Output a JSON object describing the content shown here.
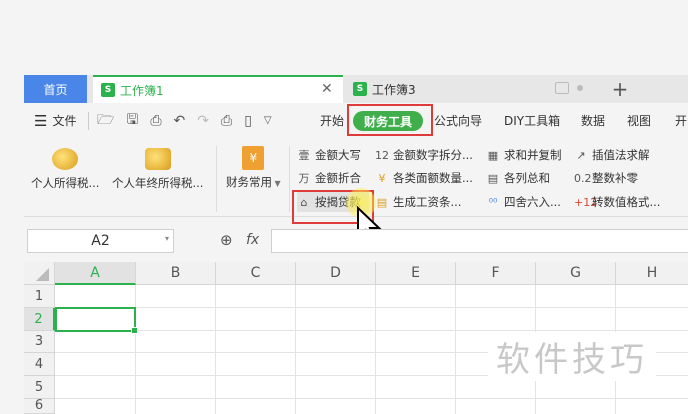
{
  "tabs": {
    "home": "首页",
    "active_doc": "工作簿1",
    "inactive_doc": "工作簿3",
    "doc_icon": "S",
    "close": "✕",
    "add": "+"
  },
  "menu": {
    "file": "文件",
    "start": "开始",
    "finance_tools": "财务工具",
    "formula_wizard": "公式向导",
    "diy_tools": "DIY工具箱",
    "data": "数据",
    "view": "视图",
    "more": "开"
  },
  "ribbon": {
    "personal_tax": "个人所得税...",
    "year_end_tax": "个人年终所得税...",
    "finance_common": "财务常用",
    "amount_uppercase": "金额大写",
    "amount_fold": "金额折合",
    "by_loan": "按揭贷款",
    "amount_split": "金额数字拆分...",
    "denomination_count": "各类面额数量...",
    "generate_payslip": "生成工资条...",
    "sum_copy": "求和并复制",
    "column_sum": "各列总和",
    "round": "四舍六入...",
    "interpolation": "插值法求解",
    "int_complement": "整数补零",
    "to_value": "转数值格式...",
    "icon_1": "壹",
    "icon_2": "万",
    "icon_3": "12",
    "icon_4": "0.2",
    "icon_5": "+12"
  },
  "formula_bar": {
    "name_box": "A2",
    "fx": "fx"
  },
  "grid": {
    "columns": [
      "A",
      "B",
      "C",
      "D",
      "E",
      "F",
      "G",
      "H"
    ],
    "rows": [
      "1",
      "2",
      "3",
      "4",
      "5",
      "6"
    ],
    "selected_cell": "A2"
  },
  "watermark": "软件技巧",
  "colors": {
    "accent_green": "#2bb24c",
    "home_tab_blue": "#4a86e8",
    "highlight_red": "#e03b3b"
  }
}
